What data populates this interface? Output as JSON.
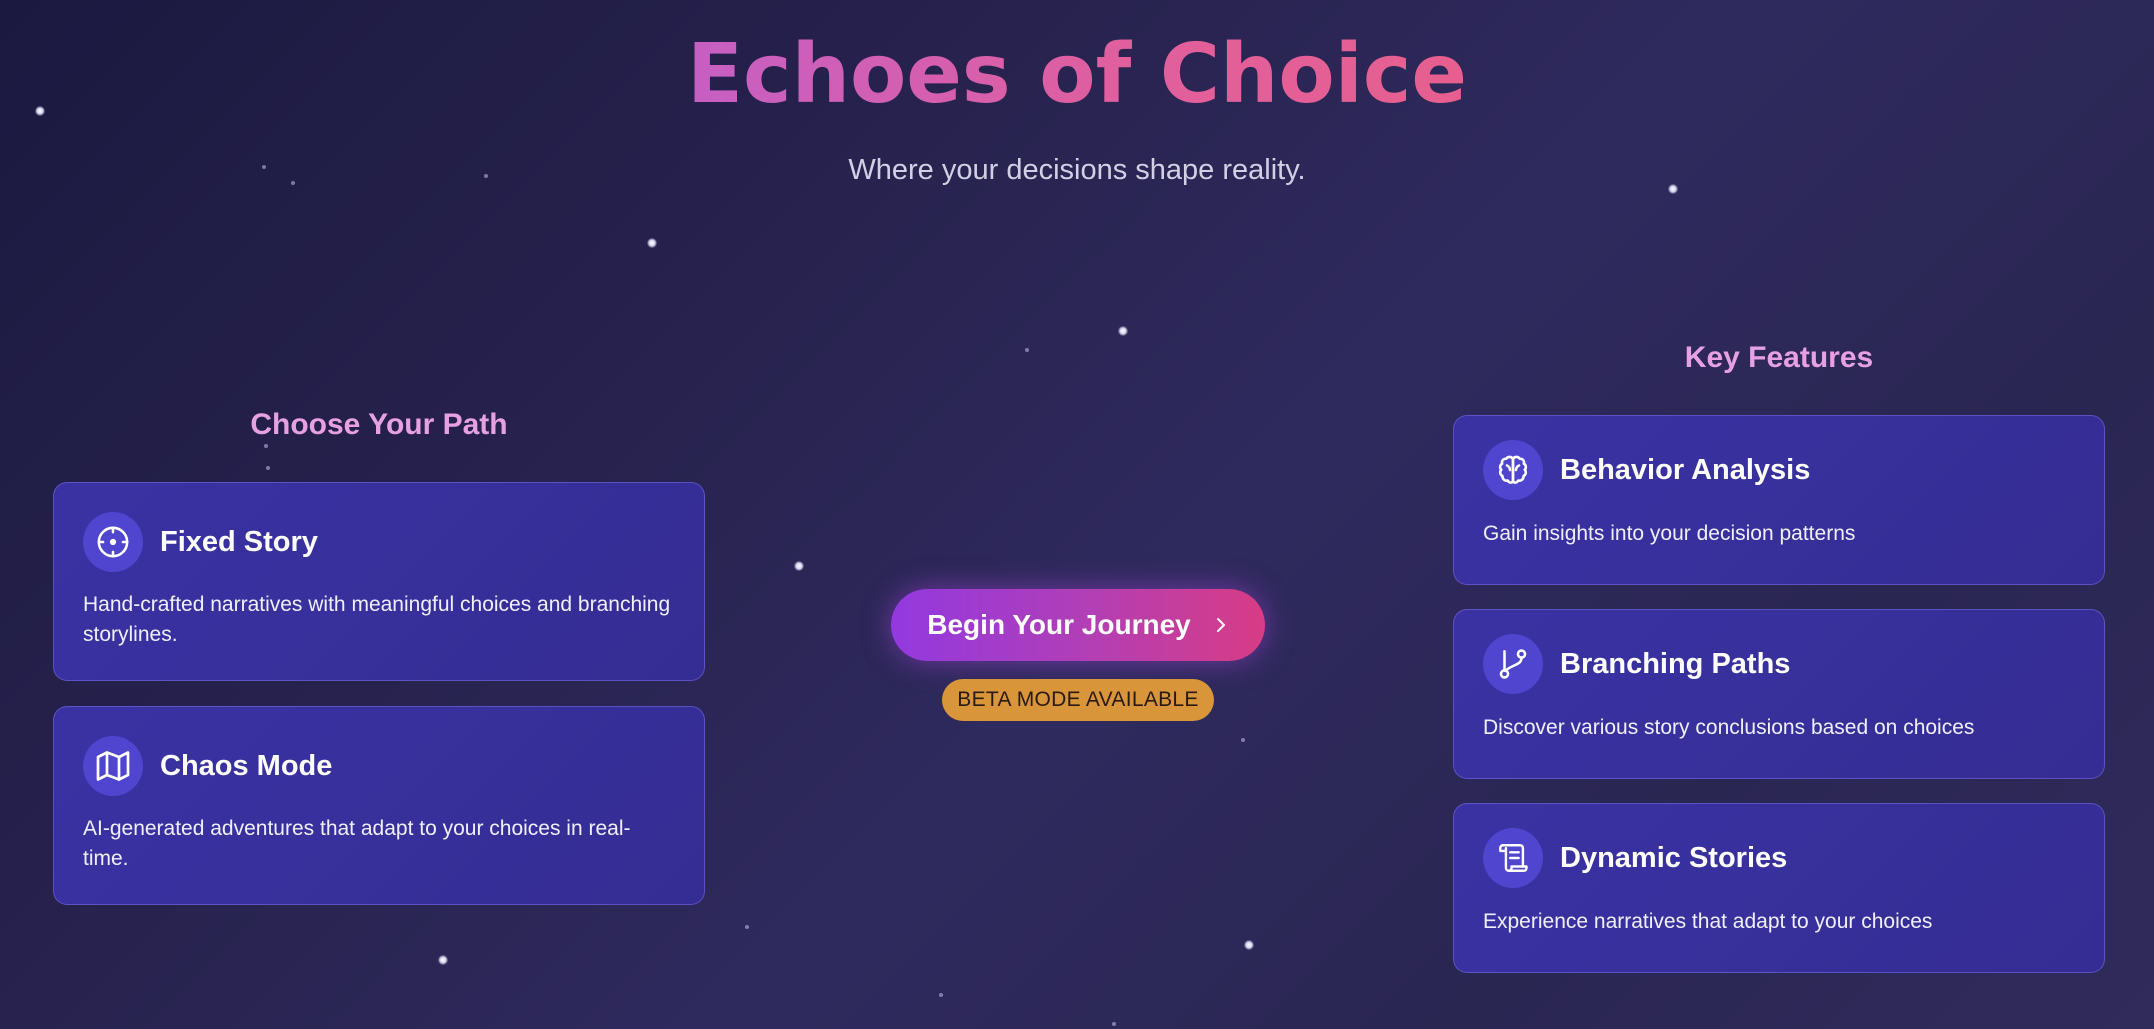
{
  "header": {
    "title": "Echoes of Choice",
    "subtitle": "Where your decisions shape reality."
  },
  "choose_path": {
    "heading": "Choose Your Path",
    "cards": [
      {
        "title": "Fixed Story",
        "description": "Hand-crafted narratives with meaningful choices and branching storylines.",
        "icon": "compass-icon"
      },
      {
        "title": "Chaos Mode",
        "description": "AI-generated adventures that adapt to your choices in real-time.",
        "icon": "map-icon"
      }
    ]
  },
  "cta": {
    "button_label": "Begin Your Journey",
    "button_icon": "chevron-right-icon",
    "badge": "BETA MODE AVAILABLE"
  },
  "key_features": {
    "heading": "Key Features",
    "cards": [
      {
        "title": "Behavior Analysis",
        "description": "Gain insights into your decision patterns",
        "icon": "brain-icon"
      },
      {
        "title": "Branching Paths",
        "description": "Discover various story conclusions based on choices",
        "icon": "git-branch-icon"
      },
      {
        "title": "Dynamic Stories",
        "description": "Experience narratives that adapt to your choices",
        "icon": "scroll-icon"
      }
    ]
  },
  "colors": {
    "background": "#28234f",
    "card": "#3a32a3",
    "icon_circle": "#4f45cf",
    "heading_accent": "#e7a1e2",
    "title_gradient_start": "#c65fc4",
    "title_gradient_end": "#e65f8e",
    "button_gradient_start": "#9239e0",
    "button_gradient_end": "#d83c84",
    "badge": "#d9953a"
  }
}
